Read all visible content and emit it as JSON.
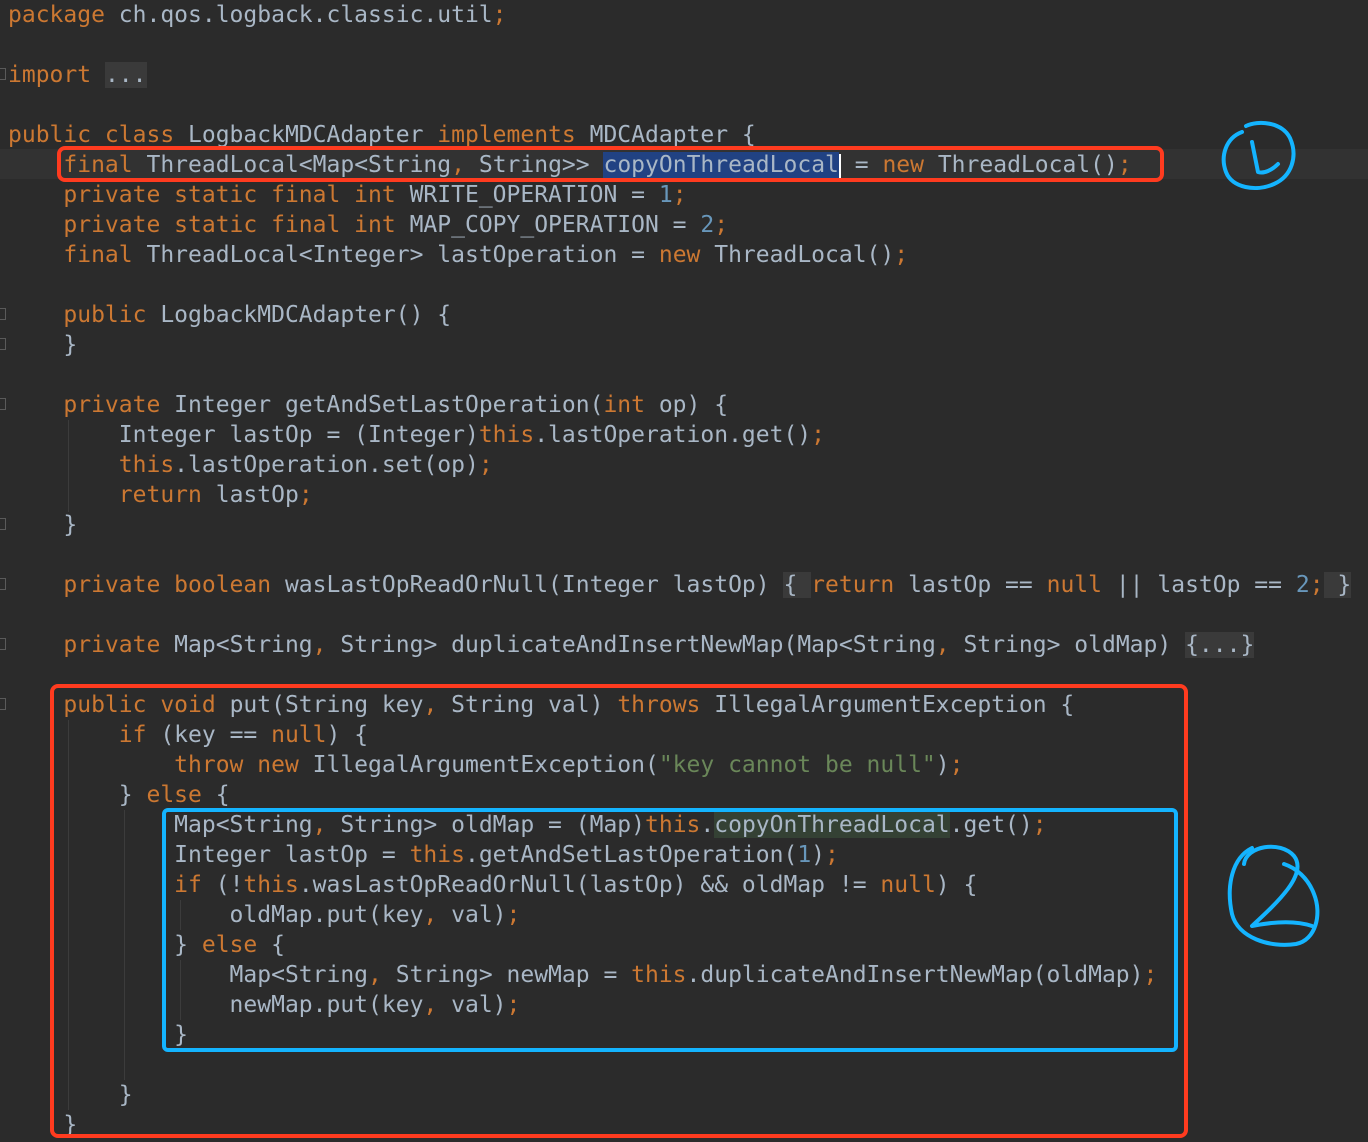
{
  "editor": {
    "language": "Java",
    "theme": "dark",
    "colors": {
      "background": "#2b2b2b",
      "text": "#a9b7c6",
      "keyword": "#cc7832",
      "number": "#6897bb",
      "string": "#6a8759",
      "selection": "#214283",
      "red_annotation": "#ff3b1f",
      "blue_annotation": "#14b4ff"
    },
    "lines": [
      {
        "id": "package",
        "tokens": [
          {
            "t": "package",
            "c": "kw"
          },
          {
            "t": " ch.qos.logback.classic.util"
          },
          {
            "t": ";",
            "c": "kw"
          }
        ]
      },
      {
        "id": "import",
        "tokens": [
          {
            "t": "import",
            "c": "kw"
          },
          {
            "t": " "
          },
          {
            "t": "...",
            "c": "fold"
          }
        ]
      },
      {
        "id": "class-decl",
        "tokens": [
          {
            "t": "public class",
            "c": "kw"
          },
          {
            "t": " LogbackMDCAdapter "
          },
          {
            "t": "implements",
            "c": "kw"
          },
          {
            "t": " MDCAdapter {"
          }
        ]
      },
      {
        "id": "field-copy",
        "tokens": [
          {
            "t": "    "
          },
          {
            "t": "final",
            "c": "kw"
          },
          {
            "t": " ThreadLocal<Map<String"
          },
          {
            "t": ",",
            "c": "kw"
          },
          {
            "t": " String>> "
          },
          {
            "t": "copyOnThreadLocal",
            "c": "sel"
          },
          {
            "caret": true
          },
          {
            "t": " = "
          },
          {
            "t": "new",
            "c": "kw"
          },
          {
            "t": " ThreadLocal()"
          },
          {
            "t": ";",
            "c": "kw"
          }
        ]
      },
      {
        "id": "field-write",
        "tokens": [
          {
            "t": "    "
          },
          {
            "t": "private static final int",
            "c": "kw"
          },
          {
            "t": " WRITE_OPERATION = "
          },
          {
            "t": "1",
            "c": "num"
          },
          {
            "t": ";",
            "c": "kw"
          }
        ]
      },
      {
        "id": "field-mapcopy",
        "tokens": [
          {
            "t": "    "
          },
          {
            "t": "private static final int",
            "c": "kw"
          },
          {
            "t": " MAP_COPY_OPERATION = "
          },
          {
            "t": "2",
            "c": "num"
          },
          {
            "t": ";",
            "c": "kw"
          }
        ]
      },
      {
        "id": "field-lastop",
        "tokens": [
          {
            "t": "    "
          },
          {
            "t": "final",
            "c": "kw"
          },
          {
            "t": " ThreadLocal<Integer> lastOperation = "
          },
          {
            "t": "new",
            "c": "kw"
          },
          {
            "t": " ThreadLocal()"
          },
          {
            "t": ";",
            "c": "kw"
          }
        ]
      },
      {
        "id": "ctor",
        "tokens": [
          {
            "t": "    "
          },
          {
            "t": "public",
            "c": "kw"
          },
          {
            "t": " LogbackMDCAdapter() {"
          }
        ]
      },
      {
        "id": "ctor-close",
        "tokens": [
          {
            "t": "    }"
          }
        ]
      },
      {
        "id": "getandset",
        "tokens": [
          {
            "t": "    "
          },
          {
            "t": "private",
            "c": "kw"
          },
          {
            "t": " Integer getAndSetLastOperation("
          },
          {
            "t": "int",
            "c": "kw"
          },
          {
            "t": " op) {"
          }
        ]
      },
      {
        "id": "getandset-1",
        "tokens": [
          {
            "t": "        Integer lastOp = (Integer)"
          },
          {
            "t": "this",
            "c": "kw"
          },
          {
            "t": ".lastOperation.get()"
          },
          {
            "t": ";",
            "c": "kw"
          }
        ]
      },
      {
        "id": "getandset-2",
        "tokens": [
          {
            "t": "        "
          },
          {
            "t": "this",
            "c": "kw"
          },
          {
            "t": ".lastOperation.set(op)"
          },
          {
            "t": ";",
            "c": "kw"
          }
        ]
      },
      {
        "id": "getandset-3",
        "tokens": [
          {
            "t": "        "
          },
          {
            "t": "return",
            "c": "kw"
          },
          {
            "t": " lastOp"
          },
          {
            "t": ";",
            "c": "kw"
          }
        ]
      },
      {
        "id": "getandset-close",
        "tokens": [
          {
            "t": "    }"
          }
        ]
      },
      {
        "id": "waslastop",
        "tokens": [
          {
            "t": "    "
          },
          {
            "t": "private boolean",
            "c": "kw"
          },
          {
            "t": " wasLastOpReadOrNull(Integer lastOp) "
          },
          {
            "t": "{ ",
            "c": "fold"
          },
          {
            "t": "return",
            "c": "kw"
          },
          {
            "t": " lastOp == "
          },
          {
            "t": "null",
            "c": "kw"
          },
          {
            "t": " || lastOp == "
          },
          {
            "t": "2",
            "c": "num"
          },
          {
            "t": ";",
            "c": "kw"
          },
          {
            "t": " }",
            "c": "fold"
          }
        ]
      },
      {
        "id": "duplicate",
        "tokens": [
          {
            "t": "    "
          },
          {
            "t": "private",
            "c": "kw"
          },
          {
            "t": " Map<String"
          },
          {
            "t": ",",
            "c": "kw"
          },
          {
            "t": " String> duplicateAndInsertNewMap(Map<String"
          },
          {
            "t": ",",
            "c": "kw"
          },
          {
            "t": " String> oldMap) "
          },
          {
            "t": "{...}",
            "c": "fold"
          }
        ]
      },
      {
        "id": "put",
        "tokens": [
          {
            "t": "    "
          },
          {
            "t": "public void",
            "c": "kw"
          },
          {
            "t": " put(String key"
          },
          {
            "t": ",",
            "c": "kw"
          },
          {
            "t": " String val) "
          },
          {
            "t": "throws",
            "c": "kw"
          },
          {
            "t": " IllegalArgumentException {"
          }
        ]
      },
      {
        "id": "put-if",
        "tokens": [
          {
            "t": "        "
          },
          {
            "t": "if",
            "c": "kw"
          },
          {
            "t": " (key == "
          },
          {
            "t": "null",
            "c": "kw"
          },
          {
            "t": ") {"
          }
        ]
      },
      {
        "id": "put-throw",
        "tokens": [
          {
            "t": "            "
          },
          {
            "t": "throw new",
            "c": "kw"
          },
          {
            "t": " IllegalArgumentException("
          },
          {
            "t": "\"key cannot be null\"",
            "c": "str"
          },
          {
            "t": ")"
          },
          {
            "t": ";",
            "c": "kw"
          }
        ]
      },
      {
        "id": "put-else",
        "tokens": [
          {
            "t": "        } "
          },
          {
            "t": "else",
            "c": "kw"
          },
          {
            "t": " {"
          }
        ]
      },
      {
        "id": "put-oldmap",
        "tokens": [
          {
            "t": "            Map<String"
          },
          {
            "t": ",",
            "c": "kw"
          },
          {
            "t": " String> oldMap = (Map)"
          },
          {
            "t": "this",
            "c": "kw"
          },
          {
            "t": "."
          },
          {
            "t": "copyOnThreadLocal",
            "c": "usage"
          },
          {
            "t": ".get()"
          },
          {
            "t": ";",
            "c": "kw"
          }
        ]
      },
      {
        "id": "put-lastop",
        "tokens": [
          {
            "t": "            Integer lastOp = "
          },
          {
            "t": "this",
            "c": "kw"
          },
          {
            "t": ".getAndSetLastOperation("
          },
          {
            "t": "1",
            "c": "num"
          },
          {
            "t": ")"
          },
          {
            "t": ";",
            "c": "kw"
          }
        ]
      },
      {
        "id": "put-if2",
        "tokens": [
          {
            "t": "            "
          },
          {
            "t": "if",
            "c": "kw"
          },
          {
            "t": " (!"
          },
          {
            "t": "this",
            "c": "kw"
          },
          {
            "t": ".wasLastOpReadOrNull(lastOp) && oldMap != "
          },
          {
            "t": "null",
            "c": "kw"
          },
          {
            "t": ") {"
          }
        ]
      },
      {
        "id": "put-oldmap-put",
        "tokens": [
          {
            "t": "                oldMap.put(key"
          },
          {
            "t": ",",
            "c": "kw"
          },
          {
            "t": " val)"
          },
          {
            "t": ";",
            "c": "kw"
          }
        ]
      },
      {
        "id": "put-else2",
        "tokens": [
          {
            "t": "            } "
          },
          {
            "t": "else",
            "c": "kw"
          },
          {
            "t": " {"
          }
        ]
      },
      {
        "id": "put-newmap",
        "tokens": [
          {
            "t": "                Map<String"
          },
          {
            "t": ",",
            "c": "kw"
          },
          {
            "t": " String> newMap = "
          },
          {
            "t": "this",
            "c": "kw"
          },
          {
            "t": ".duplicateAndInsertNewMap(oldMap)"
          },
          {
            "t": ";",
            "c": "kw"
          }
        ]
      },
      {
        "id": "put-newmap-put",
        "tokens": [
          {
            "t": "                newMap.put(key"
          },
          {
            "t": ",",
            "c": "kw"
          },
          {
            "t": " val)"
          },
          {
            "t": ";",
            "c": "kw"
          }
        ]
      },
      {
        "id": "put-inner-close",
        "tokens": [
          {
            "t": "            }"
          }
        ]
      },
      {
        "id": "put-else-close",
        "tokens": [
          {
            "t": "        }"
          }
        ]
      },
      {
        "id": "put-close",
        "tokens": [
          {
            "t": "    }"
          }
        ]
      }
    ]
  },
  "annotations": [
    {
      "id": "annotation-1",
      "color": "red",
      "label": "1",
      "covers": "copyOnThreadLocal field declaration"
    },
    {
      "id": "annotation-2-outer",
      "color": "red",
      "covers": "put method"
    },
    {
      "id": "annotation-2-inner",
      "color": "blue",
      "label": "2",
      "covers": "else branch of put"
    }
  ]
}
